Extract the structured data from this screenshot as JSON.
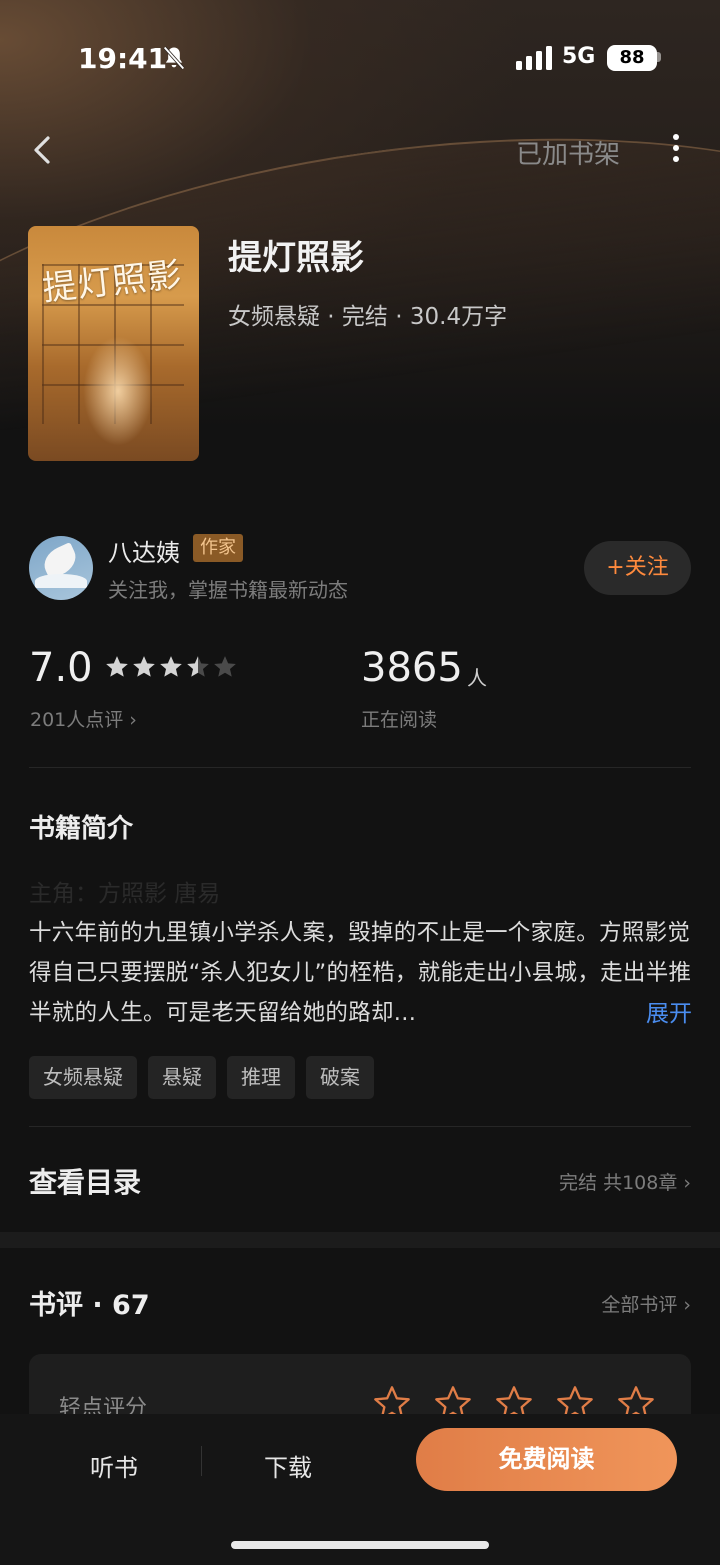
{
  "status_bar": {
    "time": "19:41",
    "network": "5G",
    "battery": "88"
  },
  "nav": {
    "shelf_label": "已加书架"
  },
  "book": {
    "title": "提灯照影",
    "meta": "女频悬疑 · 完结 · 30.4万字",
    "cover_text": "提灯照影"
  },
  "author": {
    "name": "八达姨",
    "badge": "作家",
    "subtitle": "关注我，掌握书籍最新动态",
    "follow_label": "+关注"
  },
  "stats": {
    "score": "7.0",
    "star_rating": 3.5,
    "review_count_label": "201人点评 ›",
    "readers": "3865",
    "readers_unit": "人",
    "readers_label": "正在阅读"
  },
  "synopsis": {
    "title": "书籍简介",
    "protagonist": "主角：方照影 唐易",
    "text": "十六年前的九里镇小学杀人案，毁掉的不止是一个家庭。方照影觉得自己只要摆脱“杀人犯女儿”的桎梏，就能走出小县城，走出半推半就的人生。可是老天留给她的路却...",
    "expand_label": "展开"
  },
  "tags": [
    "女频悬疑",
    "悬疑",
    "推理",
    "破案"
  ],
  "toc": {
    "title": "查看目录",
    "info": "完结 共108章 ›"
  },
  "reviews": {
    "title": "书评 · 67",
    "all_label": "全部书评 ›",
    "rate_label": "轻点评分",
    "rate_star_count": 5
  },
  "bottom_bar": {
    "listen_label": "听书",
    "download_label": "下载",
    "read_label": "免费阅读"
  },
  "colors": {
    "accent": "#ff8a3d",
    "link": "#4a8df0",
    "background": "#121212",
    "star": "#d4d4d4",
    "rate_star": "#e07d47"
  }
}
